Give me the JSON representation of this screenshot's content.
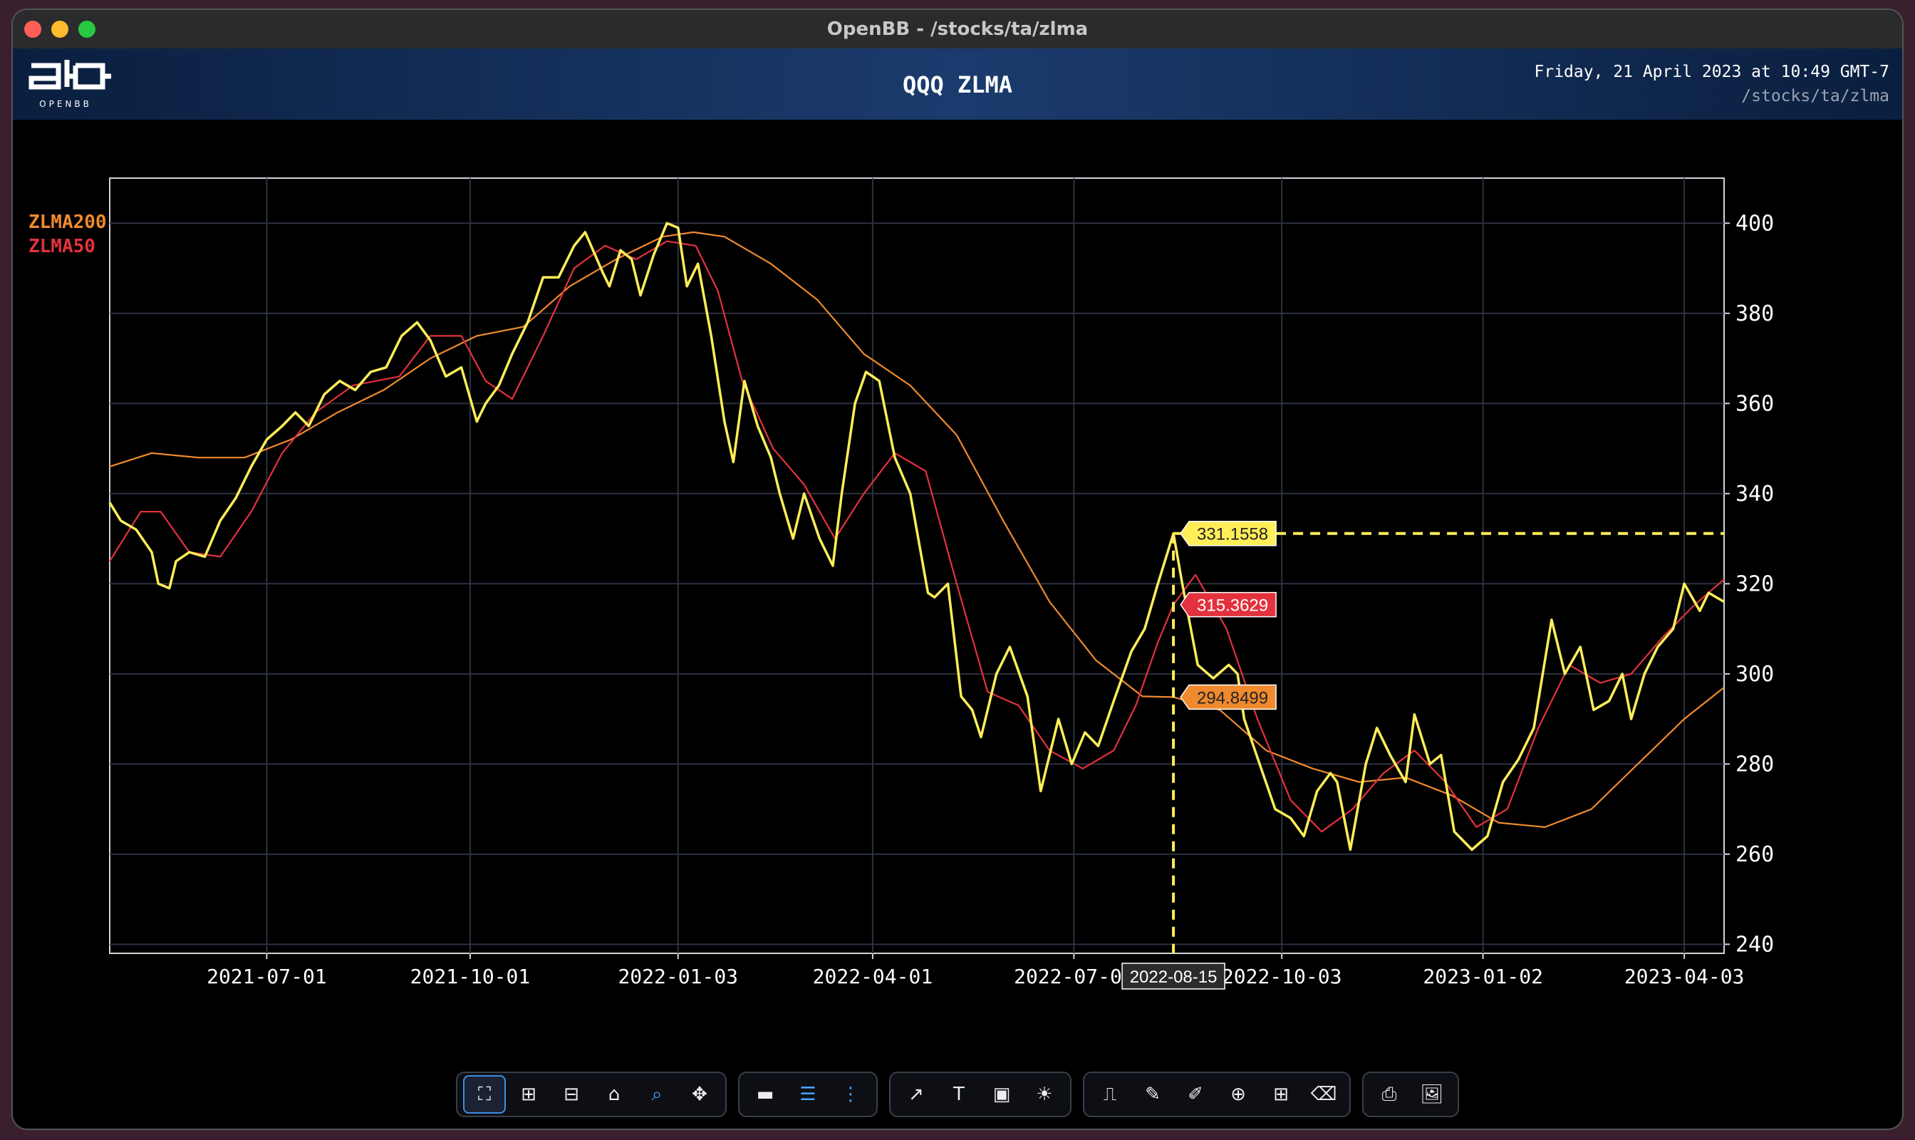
{
  "window": {
    "title": "OpenBB - /stocks/ta/zlma"
  },
  "header": {
    "logo_text": "OPENBB",
    "title": "QQQ ZLMA",
    "date": "Friday, 21 April 2023 at 10:49 GMT-7",
    "command": "/stocks/ta/zlma"
  },
  "colors": {
    "price": "#ffee58",
    "zlma200": "#ef8a2e",
    "zlma50": "#e3323d",
    "grid": "#2c3240",
    "header_bg": "#1b3b6e"
  },
  "chart_data": {
    "type": "line",
    "title": "QQQ ZLMA",
    "legend_position": "top-left",
    "grid": true,
    "x_start": "2021-04-21",
    "x_end": "2023-04-21",
    "x_tick_labels": [
      "2021-07-01",
      "2021-10-01",
      "2022-01-03",
      "2022-04-01",
      "2022-07-01",
      "2022-10-03",
      "2023-01-02",
      "2023-04-03"
    ],
    "y_ticks": [
      240,
      260,
      280,
      300,
      320,
      340,
      360,
      380,
      400
    ],
    "ylim": [
      238,
      410
    ],
    "series": [
      {
        "name": "QQQ",
        "color": "#ffee58",
        "points": [
          [
            "2021-04-21",
            338
          ],
          [
            "2021-04-26",
            334
          ],
          [
            "2021-05-03",
            332
          ],
          [
            "2021-05-10",
            327
          ],
          [
            "2021-05-13",
            320
          ],
          [
            "2021-05-18",
            319
          ],
          [
            "2021-05-21",
            325
          ],
          [
            "2021-05-27",
            327
          ],
          [
            "2021-06-03",
            326
          ],
          [
            "2021-06-10",
            334
          ],
          [
            "2021-06-17",
            339
          ],
          [
            "2021-06-24",
            346
          ],
          [
            "2021-07-01",
            352
          ],
          [
            "2021-07-08",
            355
          ],
          [
            "2021-07-14",
            358
          ],
          [
            "2021-07-20",
            355
          ],
          [
            "2021-07-27",
            362
          ],
          [
            "2021-08-03",
            365
          ],
          [
            "2021-08-10",
            363
          ],
          [
            "2021-08-17",
            367
          ],
          [
            "2021-08-24",
            368
          ],
          [
            "2021-08-31",
            375
          ],
          [
            "2021-09-07",
            378
          ],
          [
            "2021-09-13",
            374
          ],
          [
            "2021-09-20",
            366
          ],
          [
            "2021-09-27",
            368
          ],
          [
            "2021-10-04",
            356
          ],
          [
            "2021-10-08",
            360
          ],
          [
            "2021-10-14",
            364
          ],
          [
            "2021-10-20",
            371
          ],
          [
            "2021-10-27",
            378
          ],
          [
            "2021-11-03",
            388
          ],
          [
            "2021-11-10",
            388
          ],
          [
            "2021-11-17",
            395
          ],
          [
            "2021-11-22",
            398
          ],
          [
            "2021-11-30",
            389
          ],
          [
            "2021-12-03",
            386
          ],
          [
            "2021-12-08",
            394
          ],
          [
            "2021-12-13",
            392
          ],
          [
            "2021-12-17",
            384
          ],
          [
            "2021-12-23",
            393
          ],
          [
            "2021-12-29",
            400
          ],
          [
            "2022-01-03",
            399
          ],
          [
            "2022-01-07",
            386
          ],
          [
            "2022-01-12",
            391
          ],
          [
            "2022-01-18",
            375
          ],
          [
            "2022-01-24",
            356
          ],
          [
            "2022-01-28",
            347
          ],
          [
            "2022-02-02",
            365
          ],
          [
            "2022-02-08",
            355
          ],
          [
            "2022-02-14",
            348
          ],
          [
            "2022-02-18",
            340
          ],
          [
            "2022-02-24",
            330
          ],
          [
            "2022-03-01",
            340
          ],
          [
            "2022-03-08",
            330
          ],
          [
            "2022-03-14",
            324
          ],
          [
            "2022-03-18",
            340
          ],
          [
            "2022-03-24",
            360
          ],
          [
            "2022-03-29",
            367
          ],
          [
            "2022-04-04",
            365
          ],
          [
            "2022-04-11",
            348
          ],
          [
            "2022-04-18",
            340
          ],
          [
            "2022-04-26",
            318
          ],
          [
            "2022-04-29",
            317
          ],
          [
            "2022-05-05",
            320
          ],
          [
            "2022-05-11",
            295
          ],
          [
            "2022-05-16",
            292
          ],
          [
            "2022-05-20",
            286
          ],
          [
            "2022-05-27",
            300
          ],
          [
            "2022-06-02",
            306
          ],
          [
            "2022-06-10",
            295
          ],
          [
            "2022-06-16",
            274
          ],
          [
            "2022-06-24",
            290
          ],
          [
            "2022-06-30",
            280
          ],
          [
            "2022-07-06",
            287
          ],
          [
            "2022-07-12",
            284
          ],
          [
            "2022-07-19",
            294
          ],
          [
            "2022-07-27",
            305
          ],
          [
            "2022-08-02",
            310
          ],
          [
            "2022-08-08",
            320
          ],
          [
            "2022-08-15",
            331.1558
          ],
          [
            "2022-08-19",
            320
          ],
          [
            "2022-08-26",
            302
          ],
          [
            "2022-09-02",
            299
          ],
          [
            "2022-09-09",
            302
          ],
          [
            "2022-09-13",
            300
          ],
          [
            "2022-09-16",
            290
          ],
          [
            "2022-09-23",
            280
          ],
          [
            "2022-09-30",
            270
          ],
          [
            "2022-10-07",
            268
          ],
          [
            "2022-10-13",
            264
          ],
          [
            "2022-10-19",
            274
          ],
          [
            "2022-10-25",
            278
          ],
          [
            "2022-10-28",
            276
          ],
          [
            "2022-11-03",
            261
          ],
          [
            "2022-11-10",
            280
          ],
          [
            "2022-11-15",
            288
          ],
          [
            "2022-11-21",
            282
          ],
          [
            "2022-11-28",
            276
          ],
          [
            "2022-12-02",
            291
          ],
          [
            "2022-12-09",
            280
          ],
          [
            "2022-12-14",
            282
          ],
          [
            "2022-12-20",
            265
          ],
          [
            "2022-12-28",
            261
          ],
          [
            "2023-01-04",
            264
          ],
          [
            "2023-01-11",
            276
          ],
          [
            "2023-01-18",
            281
          ],
          [
            "2023-01-25",
            288
          ],
          [
            "2023-02-02",
            312
          ],
          [
            "2023-02-08",
            300
          ],
          [
            "2023-02-15",
            306
          ],
          [
            "2023-02-21",
            292
          ],
          [
            "2023-02-28",
            294
          ],
          [
            "2023-03-06",
            300
          ],
          [
            "2023-03-10",
            290
          ],
          [
            "2023-03-16",
            300
          ],
          [
            "2023-03-22",
            306
          ],
          [
            "2023-03-29",
            310
          ],
          [
            "2023-04-03",
            320
          ],
          [
            "2023-04-10",
            314
          ],
          [
            "2023-04-14",
            318
          ],
          [
            "2023-04-21",
            316
          ]
        ]
      },
      {
        "name": "ZLMA200",
        "color": "#ef8a2e",
        "points": [
          [
            "2021-04-21",
            346
          ],
          [
            "2021-05-10",
            349
          ],
          [
            "2021-05-31",
            348
          ],
          [
            "2021-06-21",
            348
          ],
          [
            "2021-07-12",
            352
          ],
          [
            "2021-08-02",
            358
          ],
          [
            "2021-08-23",
            363
          ],
          [
            "2021-09-13",
            370
          ],
          [
            "2021-10-04",
            375
          ],
          [
            "2021-10-25",
            377
          ],
          [
            "2021-11-15",
            386
          ],
          [
            "2021-12-06",
            392
          ],
          [
            "2021-12-27",
            397
          ],
          [
            "2022-01-10",
            398
          ],
          [
            "2022-01-24",
            397
          ],
          [
            "2022-02-14",
            391
          ],
          [
            "2022-03-07",
            383
          ],
          [
            "2022-03-28",
            371
          ],
          [
            "2022-04-18",
            364
          ],
          [
            "2022-05-09",
            353
          ],
          [
            "2022-05-30",
            334
          ],
          [
            "2022-06-20",
            316
          ],
          [
            "2022-07-11",
            303
          ],
          [
            "2022-08-01",
            295
          ],
          [
            "2022-08-15",
            294.8499
          ],
          [
            "2022-09-05",
            292
          ],
          [
            "2022-09-26",
            283
          ],
          [
            "2022-10-17",
            279
          ],
          [
            "2022-11-07",
            276
          ],
          [
            "2022-11-28",
            277
          ],
          [
            "2022-12-19",
            273
          ],
          [
            "2023-01-09",
            267
          ],
          [
            "2023-01-30",
            266
          ],
          [
            "2023-02-20",
            270
          ],
          [
            "2023-03-13",
            280
          ],
          [
            "2023-04-03",
            290
          ],
          [
            "2023-04-21",
            297
          ]
        ]
      },
      {
        "name": "ZLMA50",
        "color": "#e3323d",
        "points": [
          [
            "2021-04-21",
            325
          ],
          [
            "2021-05-05",
            336
          ],
          [
            "2021-05-14",
            336
          ],
          [
            "2021-05-27",
            327
          ],
          [
            "2021-06-10",
            326
          ],
          [
            "2021-06-24",
            336
          ],
          [
            "2021-07-08",
            349
          ],
          [
            "2021-07-23",
            358
          ],
          [
            "2021-08-09",
            364
          ],
          [
            "2021-08-30",
            366
          ],
          [
            "2021-09-13",
            375
          ],
          [
            "2021-09-27",
            375
          ],
          [
            "2021-10-08",
            365
          ],
          [
            "2021-10-20",
            361
          ],
          [
            "2021-11-03",
            375
          ],
          [
            "2021-11-17",
            390
          ],
          [
            "2021-12-01",
            395
          ],
          [
            "2021-12-15",
            392
          ],
          [
            "2021-12-29",
            396
          ],
          [
            "2022-01-11",
            395
          ],
          [
            "2022-01-21",
            385
          ],
          [
            "2022-02-01",
            365
          ],
          [
            "2022-02-15",
            350
          ],
          [
            "2022-03-01",
            342
          ],
          [
            "2022-03-15",
            330
          ],
          [
            "2022-03-28",
            340
          ],
          [
            "2022-04-11",
            349
          ],
          [
            "2022-04-25",
            345
          ],
          [
            "2022-05-09",
            320
          ],
          [
            "2022-05-23",
            296
          ],
          [
            "2022-06-06",
            293
          ],
          [
            "2022-06-20",
            283
          ],
          [
            "2022-07-05",
            279
          ],
          [
            "2022-07-19",
            283
          ],
          [
            "2022-07-29",
            293
          ],
          [
            "2022-08-08",
            307
          ],
          [
            "2022-08-15",
            315.3629
          ],
          [
            "2022-08-25",
            322
          ],
          [
            "2022-09-08",
            310
          ],
          [
            "2022-09-22",
            290
          ],
          [
            "2022-10-07",
            272
          ],
          [
            "2022-10-21",
            265
          ],
          [
            "2022-11-04",
            270
          ],
          [
            "2022-11-18",
            278
          ],
          [
            "2022-12-02",
            283
          ],
          [
            "2022-12-16",
            276
          ],
          [
            "2022-12-30",
            266
          ],
          [
            "2023-01-13",
            270
          ],
          [
            "2023-01-27",
            288
          ],
          [
            "2023-02-10",
            302
          ],
          [
            "2023-02-24",
            298
          ],
          [
            "2023-03-10",
            300
          ],
          [
            "2023-03-24",
            308
          ],
          [
            "2023-04-07",
            315
          ],
          [
            "2023-04-21",
            321
          ]
        ]
      }
    ],
    "crosshair": {
      "x_label": "2022-08-15",
      "values": [
        {
          "series": "QQQ",
          "value": "331.1558",
          "y": 331.1558
        },
        {
          "series": "ZLMA50",
          "value": "315.3629",
          "y": 315.3629
        },
        {
          "series": "ZLMA200",
          "value": "294.8499",
          "y": 294.8499
        }
      ]
    }
  },
  "toolbar": {
    "groups": [
      [
        "autoscale-icon",
        "zoom-in-icon",
        "zoom-out-icon",
        "home-icon",
        "zoom-icon",
        "pan-icon"
      ],
      [
        "hide-legend-icon",
        "toggle-lines-icon",
        "spike-lines-icon"
      ],
      [
        "add-indicator-icon",
        "add-text-icon",
        "add-title-icon",
        "dark-mode-icon"
      ],
      [
        "draw-line-icon",
        "draw-pen-icon",
        "draw-freeform-icon",
        "draw-circle-icon",
        "draw-rect-icon",
        "erase-shape-icon"
      ],
      [
        "export-csv-icon",
        "export-image-icon"
      ]
    ]
  }
}
